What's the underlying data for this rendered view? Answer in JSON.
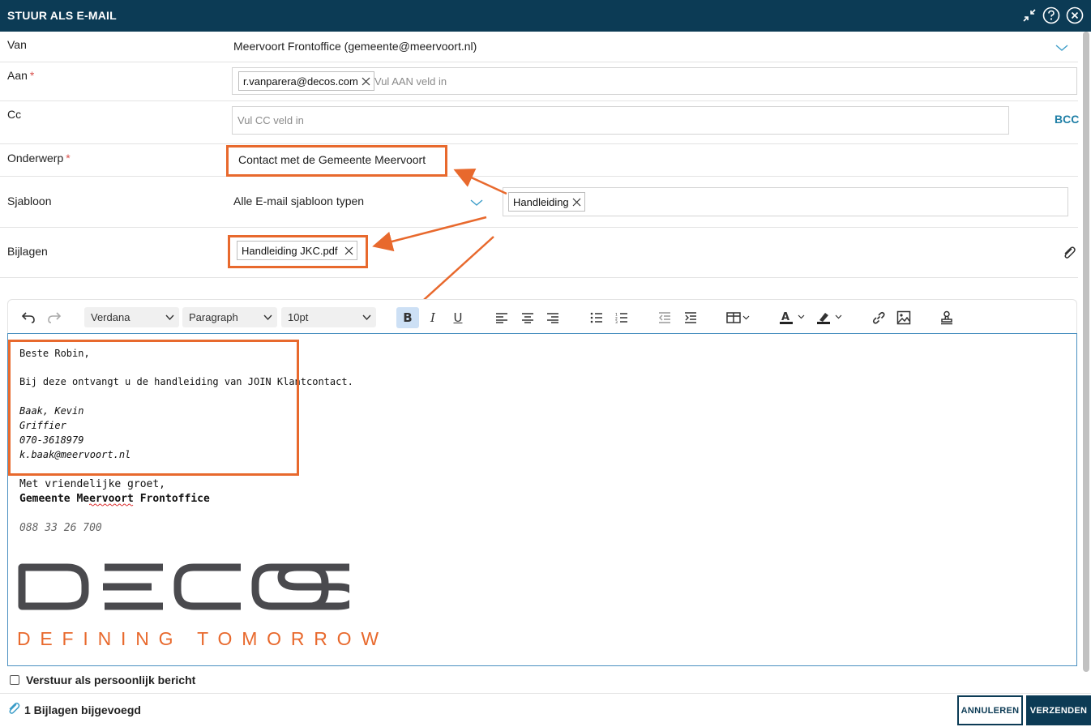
{
  "dialog": {
    "title": "STUUR ALS E-MAIL"
  },
  "icons": {
    "collapse": "collapse-arrows-icon",
    "help": "help-icon",
    "close": "close-icon"
  },
  "fields": {
    "van": {
      "label": "Van",
      "value": "Meervoort Frontoffice (gemeente@meervoort.nl)"
    },
    "aan": {
      "label": "Aan",
      "required": "*",
      "chip": "r.vanparera@decos.com",
      "placeholder": "Vul AAN veld in"
    },
    "cc": {
      "label": "Cc",
      "placeholder": "Vul CC veld in",
      "bcc_label": "BCC"
    },
    "onderwerp": {
      "label": "Onderwerp",
      "required": "*",
      "value": "Contact met de Gemeente Meervoort"
    },
    "sjabloon": {
      "label": "Sjabloon",
      "type_value": "Alle E-mail sjabloon typen",
      "chip": "Handleiding"
    },
    "bijlagen": {
      "label": "Bijlagen",
      "chip": "Handleiding JKC.pdf"
    }
  },
  "toolbar": {
    "font": "Verdana",
    "block": "Paragraph",
    "size": "10pt"
  },
  "body": {
    "greeting": "Beste Robin,",
    "line1": "Bij deze ontvangt u de handleiding van JOIN Klantcontact.",
    "sig_name": "Baak, Kevin",
    "sig_role": "Griffier",
    "sig_phone": "070-3618979",
    "sig_email": "k.baak@meervoort.nl",
    "closing": "Met vriendelijke groet,",
    "org": "Gemeente Meervoort Frontoffice",
    "org_phone": "088 33 26 700",
    "logo_word": "DECOS",
    "logo_tagline": "DEFINING TOMORROW"
  },
  "options": {
    "personal_label": "Verstuur als persoonlijk bericht"
  },
  "footer": {
    "attachments": "1 Bijlagen bijgevoegd",
    "cancel": "ANNULEREN",
    "send": "VERZENDEN"
  },
  "colors": {
    "header": "#0c3b55",
    "highlight": "#e8692d",
    "bcc": "#1f7fa6"
  }
}
